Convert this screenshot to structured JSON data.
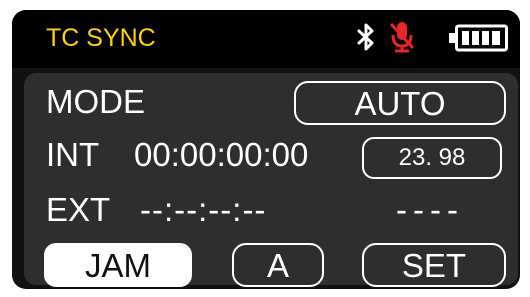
{
  "colors": {
    "title": "#ffd400",
    "mic_muted": "#e8262a",
    "text": "#ffffff",
    "panel": "#2e2e2e",
    "screen": "#111111"
  },
  "header": {
    "title": "TC SYNC",
    "icons": [
      "bluetooth-icon",
      "mic-muted-icon",
      "battery-full-icon"
    ],
    "battery_level": 1.0
  },
  "mode": {
    "label": "MODE",
    "value": "AUTO"
  },
  "internal": {
    "label": "INT",
    "timecode": "00:00:00:00",
    "fps": "23. 98"
  },
  "external": {
    "label": "EXT",
    "timecode": "--:--:--:--",
    "fps": "----"
  },
  "buttons": {
    "jam": "JAM",
    "a": "A",
    "set": "SET"
  }
}
